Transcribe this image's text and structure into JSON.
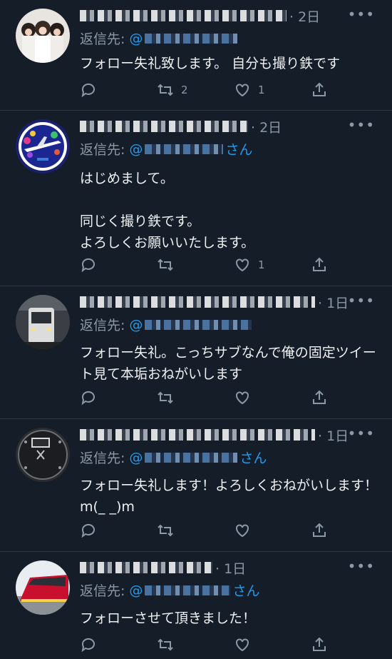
{
  "tweets": [
    {
      "time": "· 2日",
      "reply_prefix": "返信先:",
      "mention_start": "@",
      "mention_end": "",
      "body": "フォロー失礼致します。 自分も撮り鉄です",
      "actions": {
        "reply_count": "",
        "retweet_count": "2",
        "like_count": "1"
      }
    },
    {
      "time": "· 2日",
      "reply_prefix": "返信先:",
      "mention_start": "@",
      "mention_end": "さん",
      "body": "はじめまして。\n\n同じく撮り鉄です。\nよろしくお願いいたします。",
      "actions": {
        "reply_count": "",
        "retweet_count": "",
        "like_count": "1"
      }
    },
    {
      "time": "· 1日",
      "reply_prefix": "返信先:",
      "mention_start": "@",
      "mention_end": "",
      "body": "フォロー失礼。こっちサブなんで俺の固定ツイート見て本垢おねがいします",
      "actions": {
        "reply_count": "",
        "retweet_count": "",
        "like_count": ""
      }
    },
    {
      "time": "· 1日",
      "reply_prefix": "返信先:",
      "mention_start": "@",
      "mention_end": "さん",
      "body": "フォロー失礼します！よろしくおねがいします！m(_ _)m",
      "actions": {
        "reply_count": "",
        "retweet_count": "",
        "like_count": ""
      }
    },
    {
      "time": "· 1日",
      "reply_prefix": "返信先:",
      "mention_start": "@",
      "mention_end": "さん",
      "body": "フォローさせて頂きました！",
      "actions": {
        "reply_count": "",
        "retweet_count": "",
        "like_count": ""
      }
    }
  ],
  "more_glyph": "•••",
  "colors": {
    "background": "#151d28",
    "accent": "#1d9bf0",
    "muted": "#8b98a5"
  }
}
